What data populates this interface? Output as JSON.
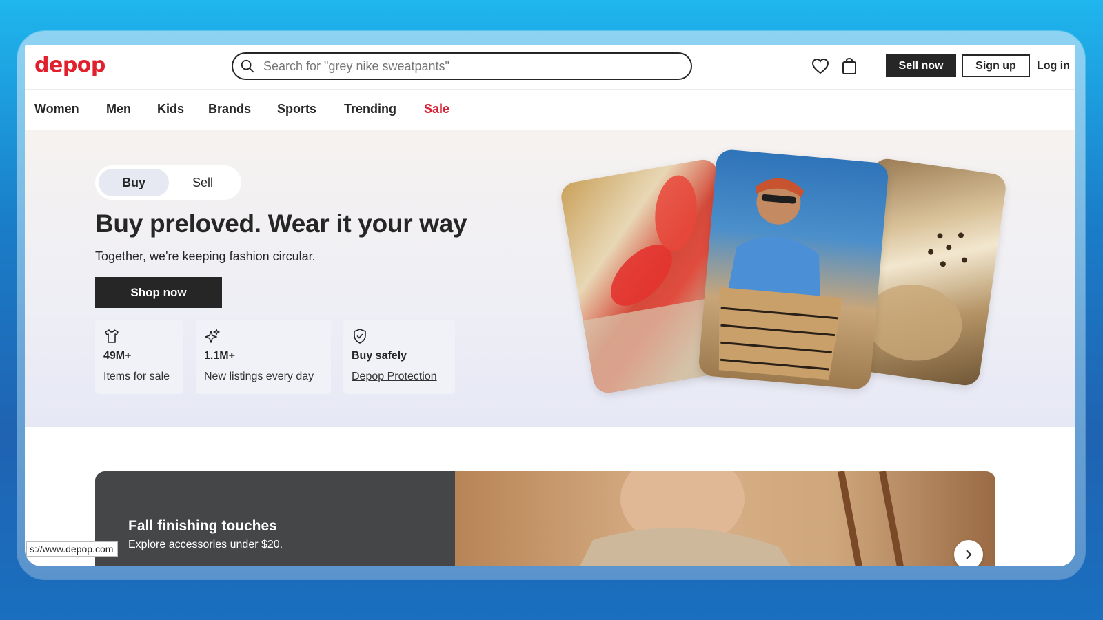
{
  "brand": {
    "logo_text": "depop",
    "logo_color": "#e0202c"
  },
  "search": {
    "placeholder": "Search for \"grey nike sweatpants\""
  },
  "header": {
    "icons": [
      "heart-icon",
      "bag-icon"
    ],
    "sell_now_label": "Sell now",
    "signup_label": "Sign up",
    "login_label": "Log in"
  },
  "nav": {
    "items": [
      {
        "label": "Women"
      },
      {
        "label": "Men"
      },
      {
        "label": "Kids"
      },
      {
        "label": "Brands"
      },
      {
        "label": "Sports"
      },
      {
        "label": "Trending"
      },
      {
        "label": "Sale",
        "color": "#d91f35"
      }
    ]
  },
  "hero": {
    "toggle": {
      "active": "Buy",
      "other": "Sell"
    },
    "headline": "Buy preloved. Wear it your way",
    "subline": "Together, we're keeping fashion circular.",
    "cta_label": "Shop now",
    "stats": [
      {
        "icon": "tshirt-icon",
        "big": "49M+",
        "small": "Items for sale"
      },
      {
        "icon": "sparkle-icon",
        "big": "1.1M+",
        "small": "New listings every day"
      },
      {
        "icon": "shield-check-icon",
        "big": "Buy safely",
        "small": "Depop Protection"
      }
    ]
  },
  "banner": {
    "title": "Fall finishing touches",
    "subtitle": "Explore accessories under $20."
  },
  "status_bar": {
    "url": "s://www.depop.com"
  }
}
